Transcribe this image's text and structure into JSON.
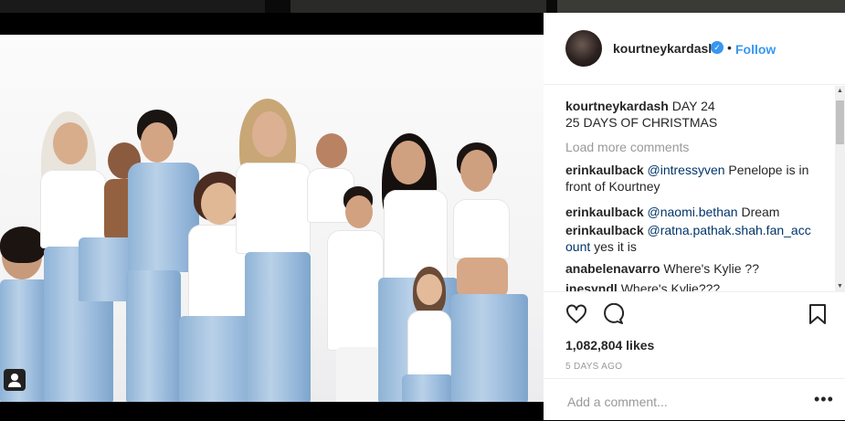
{
  "post": {
    "username": "kourtneykardash",
    "verified_icon": "verified-check-icon",
    "separator": "•",
    "follow_label": "Follow",
    "caption": {
      "user": "kourtneykardash",
      "line1": "DAY 24",
      "line2": "25 DAYS OF CHRISTMAS"
    },
    "load_more": "Load more comments",
    "comments": [
      {
        "user": "erinkaulback",
        "mention": "@intressyven",
        "text": "Penelope is in front of Kourtney"
      },
      {
        "user": "erinkaulback",
        "mention": "@naomi.bethan",
        "text": "Dream"
      },
      {
        "user": "erinkaulback",
        "mention": "@ratna.pathak.shah.fan_account",
        "text": "yes it is"
      },
      {
        "user": "anabelenavarro",
        "mention": "",
        "text": "Where's Kylie ??"
      },
      {
        "user": "inesyndl",
        "mention": "",
        "text": "Where's Kylie???"
      }
    ],
    "likes": "1,082,804 likes",
    "time_ago": "5 DAYS AGO",
    "add_comment_placeholder": "Add a comment...",
    "more_options": "•••"
  },
  "icons": {
    "like": "heart-icon",
    "comment": "comment-bubble-icon",
    "save": "bookmark-icon",
    "tags": "user-tag-icon"
  },
  "colors": {
    "accent": "#3897f0",
    "mention": "#003569",
    "muted": "#999999",
    "text": "#262626"
  }
}
